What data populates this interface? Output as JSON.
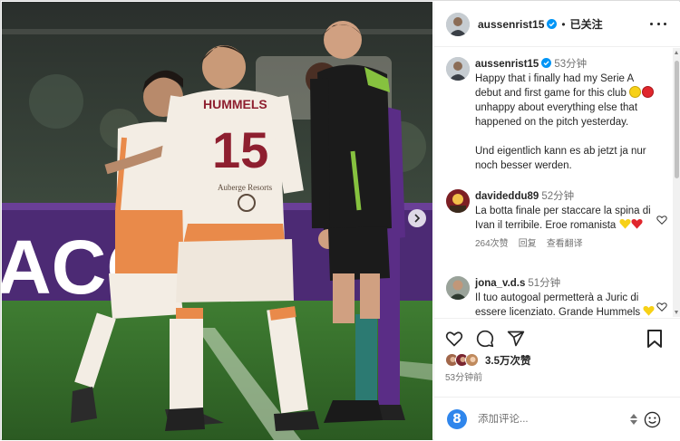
{
  "post": {
    "username": "aussenrist15",
    "follow_state": "已关注",
    "separator": "•"
  },
  "caption": {
    "username": "aussenrist15",
    "time": "53分钟",
    "text_1": "Happy that i finally had my Serie A debut and first game for this club ",
    "text_2": " unhappy about everything else that happened on the pitch yesterday.",
    "text_3": "Und eigentlich kann es ab jetzt ja nur noch besser werden."
  },
  "comments": [
    {
      "username": "davideddu89",
      "time": "52分钟",
      "text": "La botta finale per staccare la spina di Ivan il terribile. Eroe romanista ",
      "likes": "264次赞",
      "reply": "回复",
      "translate": "查看翻译"
    },
    {
      "username": "jona_v.d.s",
      "time": "51分钟",
      "text": "Il tuo autogoal permetterà a Juric di essere licenziato. Grande Hummels "
    }
  ],
  "engagement": {
    "likes": "3.5万次赞",
    "posted": "53分钟前"
  },
  "composer": {
    "placeholder": "添加评论..."
  },
  "photo": {
    "jersey_name": "HUMMELS",
    "jersey_number": "15",
    "sponsor": "Auberge Resorts",
    "board_text": "ACON"
  },
  "colors": {
    "verified": "#0095f6",
    "roma_white": "#f3ede4",
    "roma_orange": "#e98a4a",
    "roma_maroon": "#8e1f2f",
    "referee_green": "#86c23f",
    "fiorentina_purple": "#5a2d86",
    "pitch_green": "#2f6a2a"
  },
  "icons": {
    "like": "heart-icon",
    "comment": "comment-icon",
    "share": "share-icon",
    "save": "bookmark-icon",
    "more": "more-icon",
    "emoji": "smiley-icon"
  }
}
